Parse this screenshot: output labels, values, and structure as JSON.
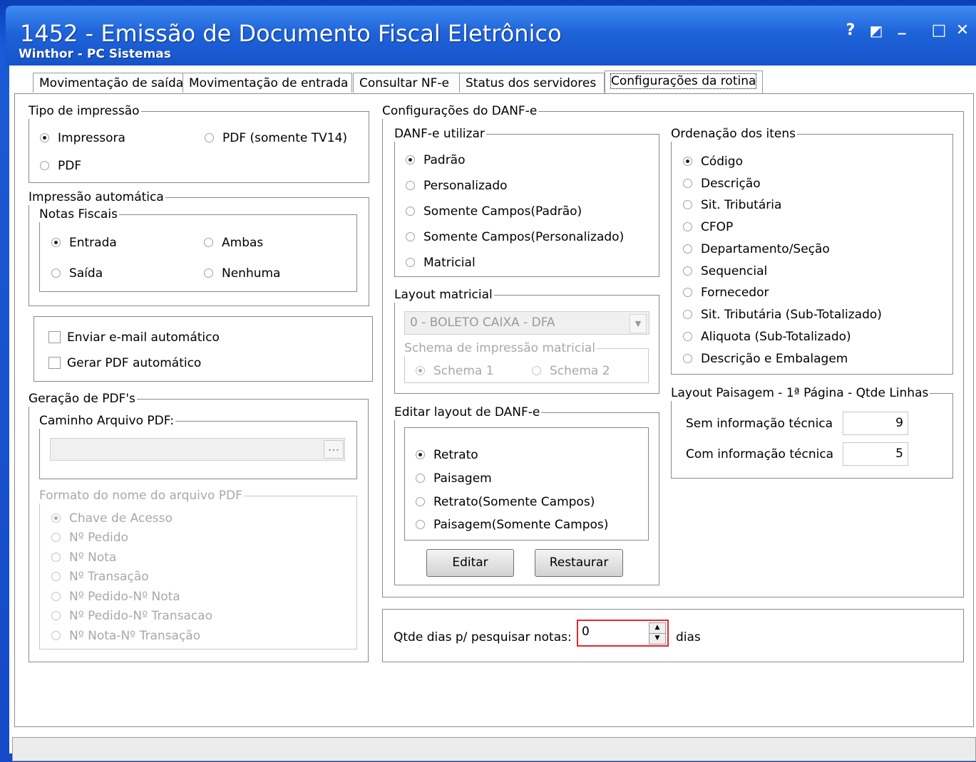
{
  "window": {
    "title": "1452 - Emissão de Documento Fiscal Eletrônico",
    "subtitle": "Winthor - PC Sistemas",
    "help_glyph": "?",
    "restore_glyph": "◩",
    "minimize_glyph": "_",
    "maximize_glyph": "□",
    "close_glyph": "✕"
  },
  "tabs": [
    {
      "label": "Movimentação de saída"
    },
    {
      "label": "Movimentação de entrada"
    },
    {
      "label": "Consultar NF-e"
    },
    {
      "label": "Status dos servidores"
    },
    {
      "label": "Configurações da rotina",
      "active": true
    }
  ],
  "tipo_impressao": {
    "title": "Tipo de impressão",
    "options": [
      "Impressora",
      "PDF (somente TV14)",
      "PDF"
    ],
    "selected": "Impressora"
  },
  "impressao_automatica": {
    "title": "Impressão automática",
    "notas_title": "Notas Fiscais",
    "options": [
      "Entrada",
      "Ambas",
      "Saída",
      "Nenhuma"
    ],
    "selected": "Entrada"
  },
  "checkboxes": {
    "email": "Enviar e-mail automático",
    "pdf": "Gerar PDF automático"
  },
  "geracao_pdf": {
    "title": "Geração de PDF's",
    "caminho_title": "Caminho Arquivo PDF:",
    "browse_label": "...",
    "formato_title": "Formato do nome do arquivo PDF",
    "formato_options": [
      "Chave de Acesso",
      "Nº Pedido",
      "Nº Nota",
      "Nº Transação",
      "Nº Pedido-Nº Nota",
      "Nº Pedido-Nº Transacao",
      "Nº Nota-Nº Transação"
    ]
  },
  "config_danfe": {
    "title": "Configurações do DANF-e",
    "utilizar_title": "DANF-e utilizar",
    "utilizar_options": [
      "Padrão",
      "Personalizado",
      "Somente Campos(Padrão)",
      "Somente Campos(Personalizado)",
      "Matricial"
    ],
    "layout_matricial_title": "Layout matricial",
    "layout_matricial_value": "0 - BOLETO CAIXA - DFA",
    "schema_title": "Schema de impressão matricial",
    "schema_options": [
      "Schema 1",
      "Schema 2"
    ],
    "editar_title": "Editar layout de DANF-e",
    "editar_options": [
      "Retrato",
      "Paisagem",
      "Retrato(Somente Campos)",
      "Paisagem(Somente Campos)"
    ],
    "editar_button": "Editar",
    "restaurar_button": "Restaurar",
    "ordenacao_title": "Ordenação dos itens",
    "ordenacao_options": [
      "Código",
      "Descrição",
      "Sit. Tributária",
      "CFOP",
      "Departamento/Seção",
      "Sequencial",
      "Fornecedor",
      "Sit. Tributária (Sub-Totalizado)",
      "Aliquota (Sub-Totalizado)",
      "Descrição e Embalagem"
    ],
    "paisagem_title": "Layout Paisagem - 1ª Página - Qtde Linhas",
    "sem_info_label": "Sem informação técnica",
    "sem_info_value": "9",
    "com_info_label": "Com informação técnica",
    "com_info_value": "5"
  },
  "qtde_dias": {
    "label": "Qtde dias p/ pesquisar notas:",
    "value": "0",
    "unit": "dias"
  },
  "colors": {
    "titlebar": "#1f63d9",
    "highlight_border": "#e3262b"
  }
}
